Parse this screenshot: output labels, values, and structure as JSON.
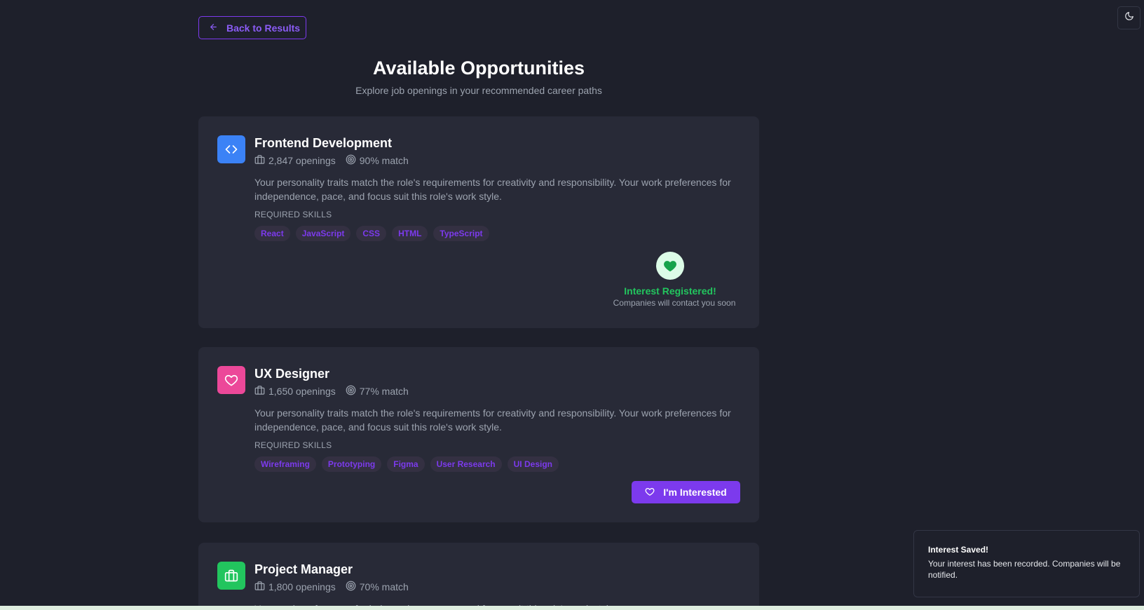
{
  "header": {
    "back_label": "Back to Results",
    "title": "Available Opportunities",
    "subtitle": "Explore job openings in your recommended career paths"
  },
  "theme_toggle": {
    "icon": "moon-icon"
  },
  "jobs": [
    {
      "title": "Frontend Development",
      "icon": "code-icon",
      "icon_color": "#3b82f6",
      "openings": "2,847 openings",
      "match": "90% match",
      "description": "Your personality traits match the role's requirements for creativity and responsibility. Your work preferences for independence, pace, and focus suit this role's work style.",
      "skills_label": "REQUIRED SKILLS",
      "skills": [
        "React",
        "JavaScript",
        "CSS",
        "HTML",
        "TypeScript"
      ],
      "status": {
        "title": "Interest Registered!",
        "subtitle": "Companies will contact you soon"
      }
    },
    {
      "title": "UX Designer",
      "icon": "heart-icon",
      "icon_color": "#ec4899",
      "openings": "1,650 openings",
      "match": "77% match",
      "description": "Your personality traits match the role's requirements for creativity and responsibility. Your work preferences for independence, pace, and focus suit this role's work style.",
      "skills_label": "REQUIRED SKILLS",
      "skills": [
        "Wireframing",
        "Prototyping",
        "Figma",
        "User Research",
        "UI Design"
      ],
      "button_label": "I'm Interested"
    },
    {
      "title": "Project Manager",
      "icon": "briefcase-icon",
      "icon_color": "#22c55e",
      "openings": "1,800 openings",
      "match": "70% match",
      "description": "Your work preferences for independence, pace, and focus suit this role's work style."
    }
  ],
  "toast": {
    "title": "Interest Saved!",
    "message": "Your interest has been recorded. Companies will be notified."
  },
  "colors": {
    "background": "#1e202b",
    "card": "#282a37",
    "accent": "#7c3aed",
    "success": "#22c55e"
  }
}
